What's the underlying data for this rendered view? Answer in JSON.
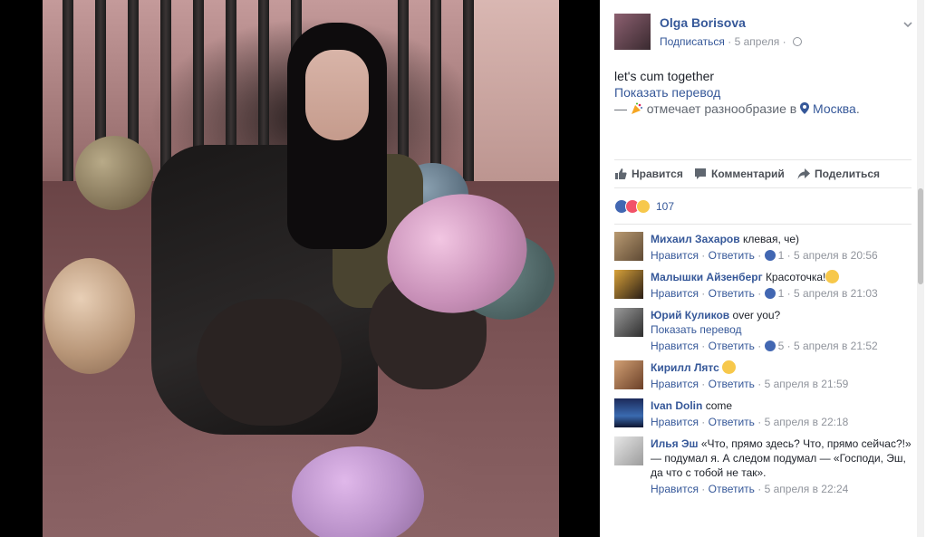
{
  "post": {
    "author": "Olga Borisova",
    "subscribe": "Подписаться",
    "date": "5 апреля",
    "separator": "·",
    "text": "let's cum together",
    "translate": "Показать перевод",
    "activity_prefix": "—",
    "activity_text": "отмечает разнообразие в",
    "location": "Москва",
    "location_suffix": "."
  },
  "actions": {
    "like": "Нравится",
    "comment": "Комментарий",
    "share": "Поделиться"
  },
  "reactions": {
    "count": "107",
    "icons": [
      "like-icon",
      "love-icon",
      "haha-icon"
    ]
  },
  "comments": [
    {
      "name": "Михаил Захаров",
      "text": "клевая, че)",
      "like": "Нравится",
      "reply": "Ответить",
      "likes": "1",
      "time": "5 апреля в 20:56",
      "dot": "·"
    },
    {
      "name": "Малышки Айзенберг",
      "text": "Красоточка!",
      "emoji": "heart-eyes-emoji",
      "like": "Нравится",
      "reply": "Ответить",
      "likes": "1",
      "time": "5 апреля в 21:03",
      "dot": "·"
    },
    {
      "name": "Юрий Куликов",
      "text": "over you?",
      "translate": "Показать перевод",
      "like": "Нравится",
      "reply": "Ответить",
      "likes": "5",
      "time": "5 апреля в 21:52",
      "dot": "·"
    },
    {
      "name": "Кирилл Лятс",
      "emoji": "smile-emoji",
      "like": "Нравится",
      "reply": "Ответить",
      "time": "5 апреля в 21:59",
      "dot": "·"
    },
    {
      "name": "Ivan Dolin",
      "text": "come",
      "like": "Нравится",
      "reply": "Ответить",
      "time": "5 апреля в 22:18",
      "dot": "·"
    },
    {
      "name": "Илья Эш",
      "text": "«Что, прямо здесь? Что, прямо сейчас?!» — подумал я. А следом подумал — «Господи, Эш, да что с тобой не так».",
      "like": "Нравится",
      "reply": "Ответить",
      "time": "5 апреля в 22:24",
      "dot": "·"
    }
  ],
  "colors": {
    "link": "#365899",
    "meta": "#90949c",
    "like_blue": "#4267b2",
    "love_red": "#f25268",
    "haha_yellow": "#f7c84b"
  }
}
